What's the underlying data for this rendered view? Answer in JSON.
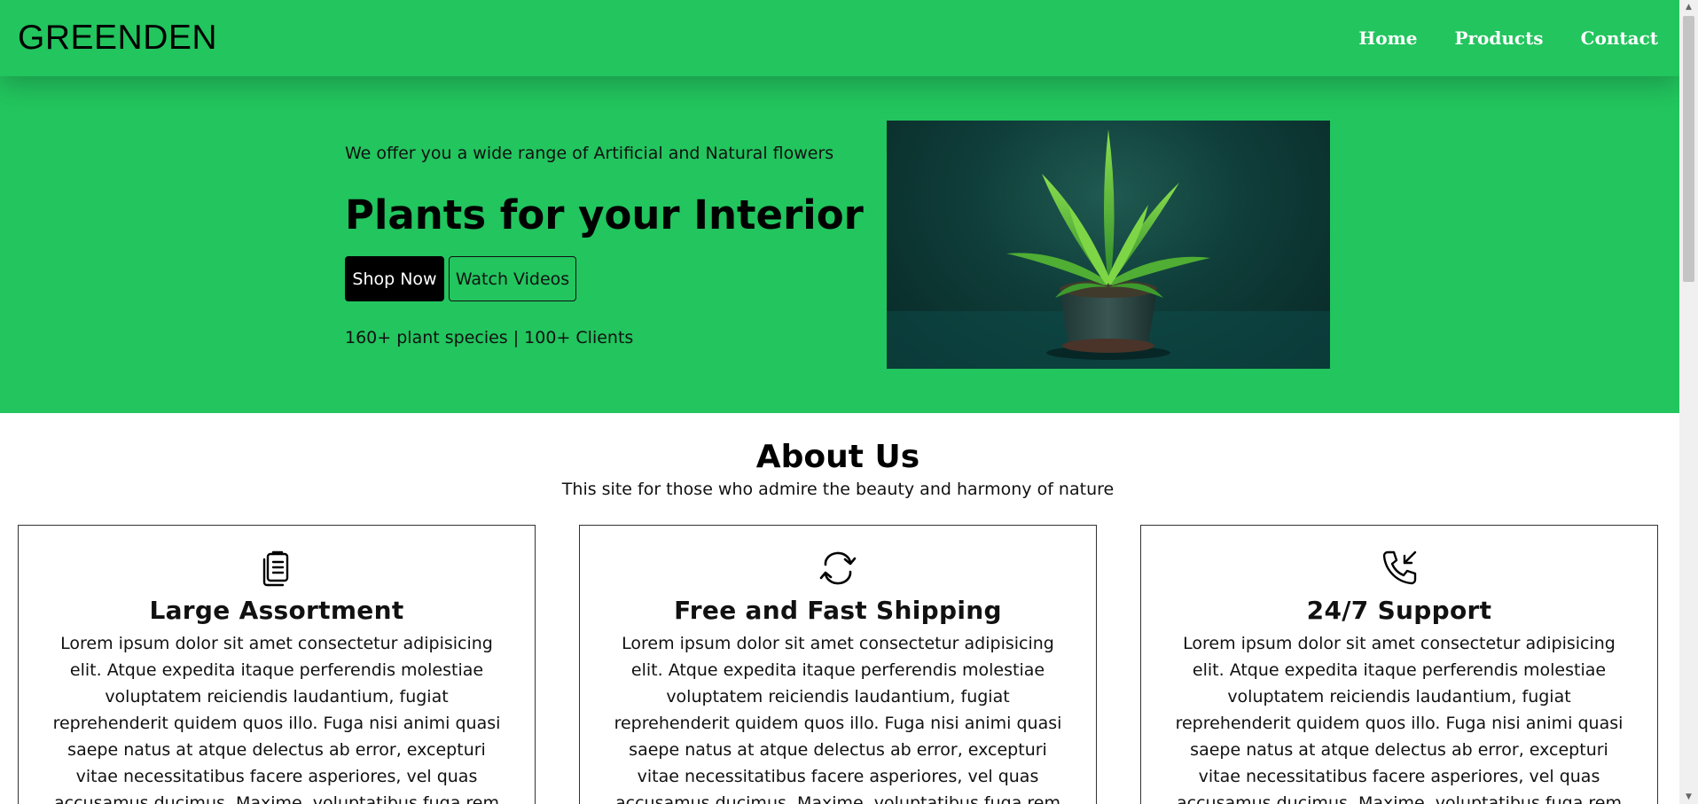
{
  "navbar": {
    "brand": "GREENDEN",
    "links": [
      "Home",
      "Products",
      "Contact"
    ]
  },
  "hero": {
    "tagline": "We offer you a wide range of Artificial and Natural flowers",
    "title": "Plants for your Interior",
    "shop_button": "Shop Now",
    "watch_button": "Watch Videos",
    "stats": "160+ plant species | 100+ Clients",
    "image_alt": "potted-plant-image"
  },
  "about": {
    "title": "About Us",
    "subtitle": "This site for those who admire the beauty and harmony of nature",
    "cards": [
      {
        "icon": "clipboard-list-icon",
        "title": "Large Assortment",
        "text": "Lorem ipsum dolor sit amet consectetur adipisicing elit. Atque expedita itaque perferendis molestiae voluptatem reiciendis laudantium, fugiat reprehenderit quidem quos illo. Fuga nisi animi quasi saepe natus at atque delectus ab error, excepturi vitae necessitatibus facere asperiores, vel quas accusamus ducimus. Maxime, voluptatibus fuga rem omnis corrupti sapiente ullam iure!"
      },
      {
        "icon": "refresh-arrows-icon",
        "title": "Free and Fast Shipping",
        "text": "Lorem ipsum dolor sit amet consectetur adipisicing elit. Atque expedita itaque perferendis molestiae voluptatem reiciendis laudantium, fugiat reprehenderit quidem quos illo. Fuga nisi animi quasi saepe natus at atque delectus ab error, excepturi vitae necessitatibus facere asperiores, vel quas accusamus ducimus. Maxime, voluptatibus fuga rem omnis corrupti sapiente ullam iure!"
      },
      {
        "icon": "phone-incoming-icon",
        "title": "24/7 Support",
        "text": "Lorem ipsum dolor sit amet consectetur adipisicing elit. Atque expedita itaque perferendis molestiae voluptatem reiciendis laudantium, fugiat reprehenderit quidem quos illo. Fuga nisi animi quasi saepe natus at atque delectus ab error, excepturi vitae necessitatibus facere asperiores, vel quas accusamus ducimus. Maxime, voluptatibus fuga rem omnis corrupti sapiente ullam iure!"
      }
    ]
  },
  "colors": {
    "brand_green": "#22c55e",
    "button_dark": "#000000",
    "text": "#111111"
  }
}
